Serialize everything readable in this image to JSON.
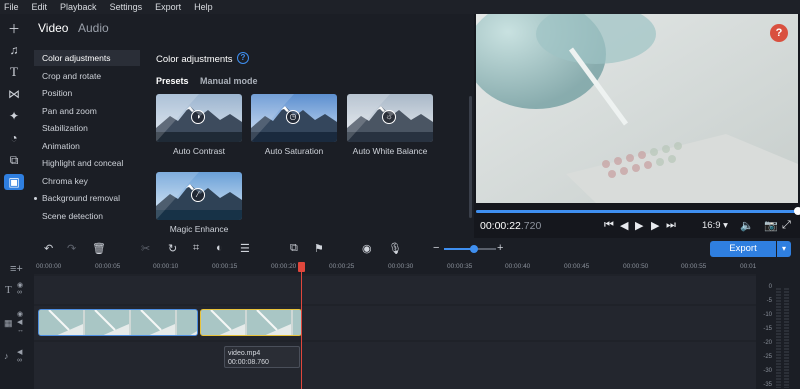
{
  "menu": [
    "File",
    "Edit",
    "Playback",
    "Settings",
    "Export",
    "Help"
  ],
  "left_tools": [
    "plus-icon",
    "music-note-icon",
    "text-icon",
    "transitions-icon",
    "magic-icon",
    "stickers-icon",
    "layers-icon",
    "more-tools-icon"
  ],
  "tabs": {
    "video": "Video",
    "audio": "Audio"
  },
  "categories": [
    {
      "label": "Color adjustments",
      "selected": true,
      "dot": false
    },
    {
      "label": "Crop and rotate",
      "selected": false,
      "dot": false
    },
    {
      "label": "Position",
      "selected": false,
      "dot": false
    },
    {
      "label": "Pan and zoom",
      "selected": false,
      "dot": false
    },
    {
      "label": "Stabilization",
      "selected": false,
      "dot": false
    },
    {
      "label": "Animation",
      "selected": false,
      "dot": false
    },
    {
      "label": "Highlight and conceal",
      "selected": false,
      "dot": false
    },
    {
      "label": "Chroma key",
      "selected": false,
      "dot": false
    },
    {
      "label": "Background removal",
      "selected": false,
      "dot": true
    },
    {
      "label": "Scene detection",
      "selected": false,
      "dot": false
    }
  ],
  "panel": {
    "title": "Color adjustments",
    "tabs": {
      "presets": "Presets",
      "manual": "Manual mode"
    },
    "presets": [
      {
        "label": "Auto Contrast",
        "icon": "contrast-icon"
      },
      {
        "label": "Auto Saturation",
        "icon": "saturation-icon"
      },
      {
        "label": "Auto White Balance",
        "icon": "white-balance-icon"
      },
      {
        "label": "Magic Enhance",
        "icon": "magic-wand-icon"
      }
    ]
  },
  "player": {
    "time_main": "00:00:22",
    "time_ms": ".720",
    "progress": 1.0,
    "aspect": "16:9 ▾",
    "help": "?"
  },
  "toolbar": {
    "export_label": "Export",
    "zoom_level": 0.58
  },
  "ruler": [
    "00:00:00",
    "00:00:05",
    "00:00:10",
    "00:00:15",
    "00:00:20",
    "00:00:25",
    "00:00:30",
    "00:00:35",
    "00:00:40",
    "00:00:45",
    "00:00:50",
    "00:00:55",
    "00:01:00"
  ],
  "tooltip": {
    "name": "video.mp4",
    "duration": "00:00:08.760"
  },
  "meter": [
    "0",
    "-5",
    "-10",
    "-15",
    "-20",
    "-25",
    "-30",
    "-35",
    "-40",
    "-45"
  ],
  "colors": {
    "accent": "#2f7fe0",
    "playhead": "#e0473c",
    "selected_clip": "#e8c23a"
  }
}
